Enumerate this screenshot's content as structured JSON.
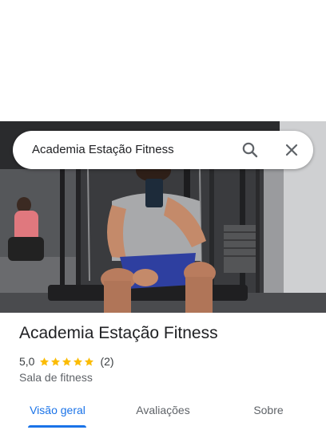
{
  "search": {
    "query": "Academia Estação Fitness"
  },
  "place": {
    "name": "Academia Estação Fitness",
    "rating": "5,0",
    "stars": 5,
    "review_count": "(2)",
    "category": "Sala de fitness"
  },
  "tabs": [
    {
      "label": "Visão geral",
      "active": true
    },
    {
      "label": "Avaliações",
      "active": false
    },
    {
      "label": "Sobre",
      "active": false
    }
  ],
  "icons": {
    "search": "search-icon",
    "close": "close-icon",
    "star": "star-icon"
  },
  "colors": {
    "accent": "#1a73e8",
    "star": "#fbbc04",
    "title": "#202124",
    "secondary": "#5f6368"
  }
}
